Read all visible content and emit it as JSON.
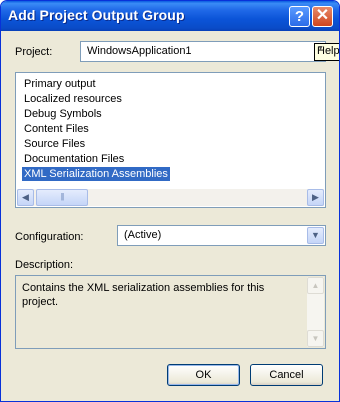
{
  "window": {
    "title": "Add Project Output Group"
  },
  "titlebar_buttons": {
    "help": "?",
    "close": "✕"
  },
  "project": {
    "label": "Project:",
    "value": "WindowsApplication1",
    "tooltip": "Help"
  },
  "outputs": {
    "items": [
      {
        "label": "Primary output",
        "selected": false
      },
      {
        "label": "Localized resources",
        "selected": false
      },
      {
        "label": "Debug Symbols",
        "selected": false
      },
      {
        "label": "Content Files",
        "selected": false
      },
      {
        "label": "Source Files",
        "selected": false
      },
      {
        "label": "Documentation Files",
        "selected": false
      },
      {
        "label": "XML Serialization Assemblies",
        "selected": true
      }
    ]
  },
  "configuration": {
    "label": "Configuration:",
    "value": "(Active)"
  },
  "description": {
    "label": "Description:",
    "text": "Contains the XML serialization assemblies for this project."
  },
  "buttons": {
    "ok": "OK",
    "cancel": "Cancel"
  },
  "colors": {
    "titlebar": "#0a54d8",
    "selection": "#316ac5",
    "dialog_bg": "#ece9d8"
  }
}
